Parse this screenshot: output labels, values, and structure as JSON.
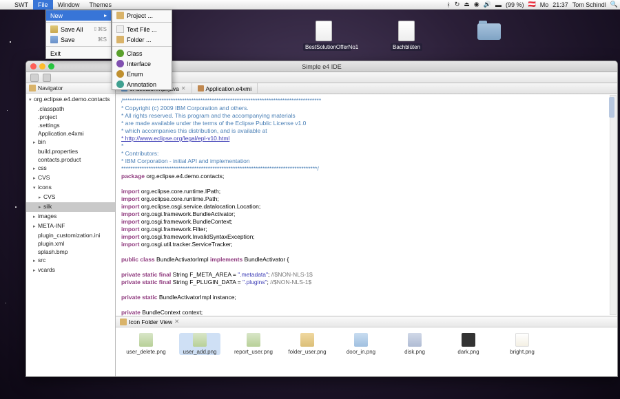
{
  "menubar": {
    "apple": "",
    "items": [
      "SWT",
      "File",
      "Window",
      "Themes"
    ],
    "selected": 1,
    "right": {
      "bt": "",
      "wifi": "",
      "vol": "",
      "flag": "",
      "batt_pct": "(99 %)",
      "flag2": "",
      "day": "Mo",
      "time": "21:37",
      "user": "Tom Schindl"
    }
  },
  "dd_file": {
    "new": "New",
    "save_all": "Save All",
    "save_all_kb": "⇧⌘S",
    "save": "Save",
    "save_kb": "⌘S",
    "exit": "Exit"
  },
  "dd_new": {
    "project": "Project ...",
    "textfile": "Text File ...",
    "folder": "Folder ...",
    "class": "Class",
    "interface": "Interface",
    "enum": "Enum",
    "annotation": "Annotation"
  },
  "desktop_icons": [
    {
      "name": "BestSolutionOfferNo1",
      "type": "file"
    },
    {
      "name": "Bachblüten",
      "type": "file"
    },
    {
      "name": "",
      "type": "folder"
    }
  ],
  "ide": {
    "title": "Simple e4 IDE",
    "nav_tab": "Navigator",
    "nav_tree": [
      {
        "t": "▾",
        "l": "org.eclipse.e4.demo.contacts",
        "ind": 0
      },
      {
        "t": "",
        "l": ".classpath",
        "ind": 1
      },
      {
        "t": "",
        "l": ".project",
        "ind": 1
      },
      {
        "t": "",
        "l": ".settings",
        "ind": 1
      },
      {
        "t": "",
        "l": "Application.e4xmi",
        "ind": 1
      },
      {
        "t": "▸",
        "l": "bin",
        "ind": 1
      },
      {
        "t": "",
        "l": "build.properties",
        "ind": 1
      },
      {
        "t": "",
        "l": "contacts.product",
        "ind": 1
      },
      {
        "t": "▸",
        "l": "css",
        "ind": 1
      },
      {
        "t": "▸",
        "l": "CVS",
        "ind": 1
      },
      {
        "t": "▾",
        "l": "icons",
        "ind": 1
      },
      {
        "t": "▸",
        "l": "CVS",
        "ind": 2
      },
      {
        "t": "▸",
        "l": "silk",
        "ind": 2,
        "sel": true
      },
      {
        "t": "▸",
        "l": "images",
        "ind": 1
      },
      {
        "t": "▸",
        "l": "META-INF",
        "ind": 1
      },
      {
        "t": "",
        "l": "plugin_customization.ini",
        "ind": 1
      },
      {
        "t": "",
        "l": "plugin.xml",
        "ind": 1
      },
      {
        "t": "",
        "l": "splash.bmp",
        "ind": 1
      },
      {
        "t": "▸",
        "l": "src",
        "ind": 1
      },
      {
        "t": "▸",
        "l": "vcards",
        "ind": 1
      }
    ],
    "tabs": [
      {
        "label": "eActivatorImpl.java",
        "active": true
      },
      {
        "label": "Application.e4xmi",
        "active": false
      }
    ],
    "code": [
      {
        "cls": "c-cm",
        "txt": "/***************************************************************************************"
      },
      {
        "cls": "c-cm",
        "txt": " * Copyright (c) 2009 IBM Corporation and others."
      },
      {
        "cls": "c-cm",
        "txt": " * All rights reserved. This program and the accompanying materials"
      },
      {
        "cls": "c-cm",
        "txt": " * are made available under the terms of the Eclipse Public License v1.0"
      },
      {
        "cls": "c-cm",
        "txt": " * which accompanies this distribution, and is available at"
      },
      {
        "cls": "c-ln",
        "txt": " * http://www.eclipse.org/legal/epl-v10.html"
      },
      {
        "cls": "c-cm",
        "txt": " *"
      },
      {
        "cls": "c-cm",
        "txt": " * Contributors:"
      },
      {
        "cls": "c-cm",
        "txt": " *     IBM Corporation - initial API and implementation"
      },
      {
        "cls": "c-cm",
        "txt": " **************************************************************************************/"
      },
      {
        "raw": "<span class='c-kw'>package</span> org.eclipse.e4.demo.contacts;"
      },
      {
        "raw": ""
      },
      {
        "raw": "<span class='c-kw'>import</span> org.eclipse.core.runtime.IPath;"
      },
      {
        "raw": "<span class='c-kw'>import</span> org.eclipse.core.runtime.Path;"
      },
      {
        "raw": "<span class='c-kw'>import</span> org.eclipse.osgi.service.datalocation.Location;"
      },
      {
        "raw": "<span class='c-kw'>import</span> org.osgi.framework.BundleActivator;"
      },
      {
        "raw": "<span class='c-kw'>import</span> org.osgi.framework.BundleContext;"
      },
      {
        "raw": "<span class='c-kw'>import</span> org.osgi.framework.Filter;"
      },
      {
        "raw": "<span class='c-kw'>import</span> org.osgi.framework.InvalidSyntaxException;"
      },
      {
        "raw": "<span class='c-kw'>import</span> org.osgi.util.tracker.ServiceTracker;"
      },
      {
        "raw": ""
      },
      {
        "raw": "<span class='c-kw'>public class</span> BundleActivatorImpl <span class='c-kw'>implements</span> BundleActivator {"
      },
      {
        "raw": ""
      },
      {
        "raw": "    <span class='c-kw'>private static final</span> String F_META_AREA = <span class='c-st'>\".metadata\"</span>; <span class='c-co'>//$NON-NLS-1$</span>"
      },
      {
        "raw": "    <span class='c-kw'>private static final</span> String F_PLUGIN_DATA = <span class='c-st'>\".plugins\"</span>; <span class='c-co'>//$NON-NLS-1$</span>"
      },
      {
        "raw": ""
      },
      {
        "raw": "    <span class='c-kw'>private static</span> BundleActivatorImpl instance;"
      },
      {
        "raw": ""
      },
      {
        "raw": "    <span class='c-kw'>private</span> BundleContext context;"
      }
    ],
    "ifv": {
      "title": "Icon Folder View",
      "icons": [
        {
          "lbl": "user_delete.png",
          "cls": "ic-user"
        },
        {
          "lbl": "user_add.png",
          "cls": "ic-user",
          "sel": true
        },
        {
          "lbl": "report_user.png",
          "cls": "ic-user"
        },
        {
          "lbl": "folder_user.png",
          "cls": "ic-fold"
        },
        {
          "lbl": "door_in.png",
          "cls": "ic-door"
        },
        {
          "lbl": "disk.png",
          "cls": "ic-disk"
        },
        {
          "lbl": "dark.png",
          "cls": "ic-dark"
        },
        {
          "lbl": "bright.png",
          "cls": "ic-bright"
        }
      ]
    }
  }
}
